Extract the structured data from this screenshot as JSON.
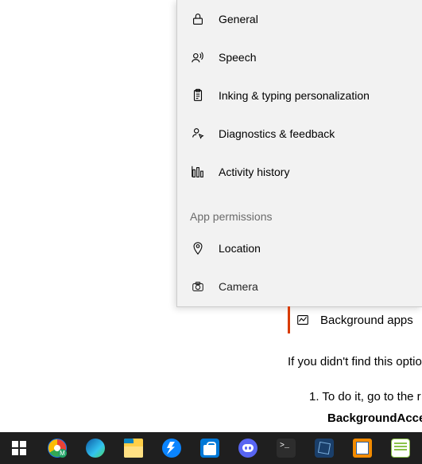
{
  "settings": {
    "items": [
      {
        "label": "General",
        "icon": "lock"
      },
      {
        "label": "Speech",
        "icon": "speech"
      },
      {
        "label": "Inking & typing personalization",
        "icon": "clipboard"
      },
      {
        "label": "Diagnostics & feedback",
        "icon": "feedback"
      },
      {
        "label": "Activity history",
        "icon": "history"
      }
    ],
    "section_header": "App permissions",
    "perm_items": [
      {
        "label": "Location",
        "icon": "location"
      },
      {
        "label": "Camera",
        "icon": "camera"
      }
    ]
  },
  "highlighted": {
    "label": "Background apps"
  },
  "article": {
    "line": "If you didn't find this optio",
    "step_num": "1.",
    "step_text": "To do it, go to the r",
    "bold": "BackgroundAcces"
  },
  "taskbar": {
    "items": [
      "start",
      "chrome",
      "edge",
      "file-explorer",
      "thunderbird",
      "microsoft-store",
      "discord",
      "terminal",
      "virtualbox",
      "vmware",
      "notepad"
    ]
  }
}
